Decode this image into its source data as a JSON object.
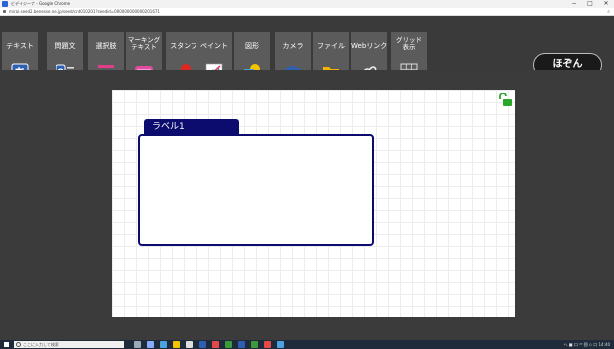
{
  "window": {
    "title": "ビデイジーナ - Google Chrome",
    "url": "mirai.seed2.benesse.ne.jp/seed/cnt010201?seedid=000000000000201671",
    "controls": [
      "−",
      "□",
      "✕"
    ]
  },
  "toolbar": {
    "tools": [
      {
        "label": "テキスト",
        "icon": "text-box-icon"
      },
      {
        "label": "問題文",
        "icon": "question-text-icon"
      },
      {
        "label": "選択肢",
        "icon": "choice-list-icon"
      },
      {
        "label": "マーキング\nテキスト",
        "icon": "marking-text-icon"
      },
      {
        "label": "スタンプ",
        "icon": "stamp-pin-icon"
      },
      {
        "label": "ペイント",
        "icon": "paint-icon"
      },
      {
        "label": "図形",
        "icon": "shapes-icon"
      },
      {
        "label": "カメラ",
        "icon": "camera-icon"
      },
      {
        "label": "ファイル",
        "icon": "folder-icon"
      },
      {
        "label": "Webリンク",
        "icon": "web-link-icon"
      },
      {
        "label": "グリッド\n表示",
        "icon": "grid-icon"
      }
    ],
    "save_label": "ほぞん"
  },
  "canvas": {
    "label_title": "ラベル1"
  },
  "taskbar": {
    "search_placeholder": "ここに入力して検索",
    "tray_text": "へ ■ 口 ⁴⁰ 囲 ◇ 口 14:40"
  },
  "colors": {
    "label_navy": "#0c0c6e",
    "toolbar_bg": "#3a3a3a",
    "tool_bg": "#5b5b5b",
    "unlock_green": "#2aa62a"
  }
}
